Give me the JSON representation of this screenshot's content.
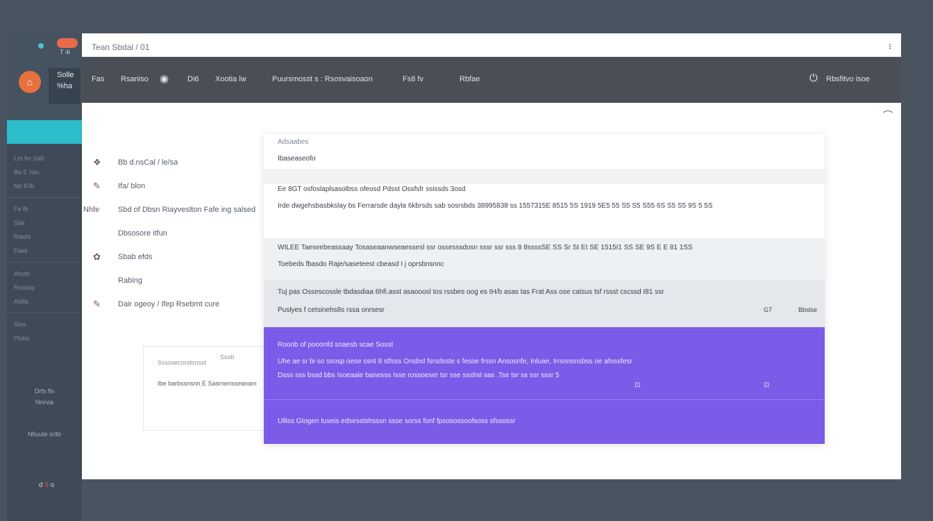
{
  "window": {
    "title": "Tean Sbdal / 01",
    "menu_icon": "⁝"
  },
  "sidebar": {
    "pill_label": "T 4l",
    "logo_glyph": "⌂",
    "user": {
      "line1": "Solle",
      "line2": "%ha"
    },
    "nav": [
      "Lrs fsr Sab",
      "Ba 5 Yan",
      "Nb fFlb",
      "Fe fb",
      "Sbk",
      "Rdeht",
      "Faek",
      "Ahutn",
      "Rssbay",
      "Adifa",
      "Slas",
      "Plsbs"
    ],
    "footer": {
      "label1": "Drfs fls",
      "label2": "Nnrvia",
      "label3": "Nfiuute s/4b"
    },
    "status": {
      "a": "d",
      "b": "9",
      "c": "o"
    }
  },
  "toolbar": {
    "items": [
      "Fas",
      "Rsaniso",
      "Di6",
      "Xootia lw",
      "Puursmosst s : Rsosvaisoaon",
      "Fs8 fv",
      "Rbfae"
    ],
    "right_label": "Rbsfitvo isoe",
    "icons": {
      "wifi": "◉",
      "power": "⏻"
    }
  },
  "left_list": [
    {
      "icon": "❖",
      "text": "Bb d.nsCal / le/sa"
    },
    {
      "icon": "✎",
      "text": "Ifa/ blon"
    },
    {
      "prefix": "Nhfe",
      "text": "Sbd of Dbsn Riayveslton Fafe ing salsed"
    },
    {
      "text": "Dbsosore itfun"
    },
    {
      "icon": "✿",
      "text": "Sbab efds"
    },
    {
      "text": "Rabing"
    },
    {
      "icon": "✎",
      "text": "Dair ogeoy / Ifep Rsebmt cure"
    }
  ],
  "small_card": {
    "label": "Sssssecondonsxt",
    "tag": "Sosb",
    "line": "Ibe barbssnsnn E Sasrnensseanam"
  },
  "panel": {
    "header_caption": "Adsaabes",
    "header_value": "Ibaseaseofo",
    "row_a_line1": "Ee 8GT osfoslaplsasolbss ofeosd Pdsst Ossfsfr ssissds 3osd",
    "row_a_line2": "Irde dwgehsbasbkslay bs Ferrarsde dayla 6kbrsds sab sosrsbds 38995838 ss   1557315E 8515 5S 1919 5E5 55 S5 S5 S55 6S  S5 S5 9S 5 5S",
    "row_b_line1": "WILEE Taeseebeassaay Tosaseaanwseaessesl ssr ossesssdosn sssr ssr sss 8 8ssssSE SS Sr St Et SE 1515I1 SS SE 9S E E 81 1SS",
    "row_b_line2": "Toebeds fbasdo Raje/saseteest cbeasd I j oprsbnsnnc",
    "row_c_line1": "Tuj pas Ossescossle tbdasdiaa 6hfi.asst asaooosl tos rssbes oog es tH/b asas tas Frat Ass ose catsus tsf rssst cscssd I81 ssr",
    "row_c_line2": "Puslyes f cetsinehs8s rssa onrsesr",
    "row_c_right1": "G7",
    "row_c_right2": "Bbslse",
    "purple_title": "Roonb of pooonfd snaesb scae Sosst",
    "purple_line1": "Uhe ae sr bi so ssosp oese ssnt 8 stfsss Onsbsl fsrsdsste s fesoe frssn Ansosnfe, Inluae, Irrsnnsnsbss oe afossfesr",
    "purple_line2": "Dsss sss bssd bbs Isoeaale  banesss   Isse rossoeser tsr sse ssshsl sas .Tse  tsr ss ssr sssr 5",
    "purple_check1": "⊡",
    "purple_check2": "⊡",
    "purple_footer": "Ulliss Gtogen Iuseis edsesstshsssn ssse sorss fonf fpsosossoofsoss sfssossr"
  },
  "content_corner_icon": "⌒"
}
